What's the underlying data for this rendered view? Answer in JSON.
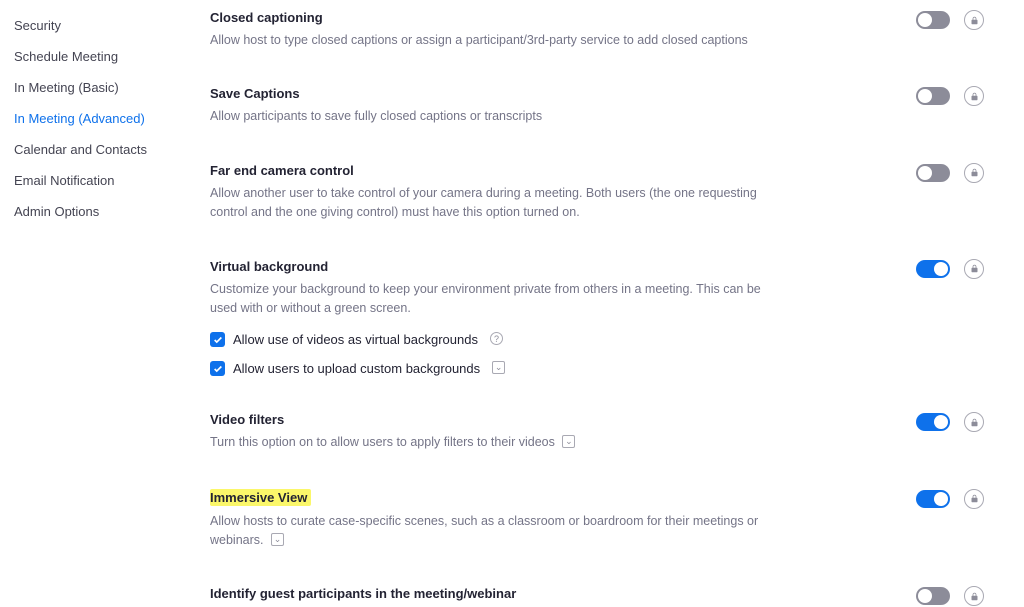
{
  "sidebar": {
    "items": [
      {
        "label": "Security",
        "active": false
      },
      {
        "label": "Schedule Meeting",
        "active": false
      },
      {
        "label": "In Meeting (Basic)",
        "active": false
      },
      {
        "label": "In Meeting (Advanced)",
        "active": true
      },
      {
        "label": "Calendar and Contacts",
        "active": false
      },
      {
        "label": "Email Notification",
        "active": false
      },
      {
        "label": "Admin Options",
        "active": false
      }
    ]
  },
  "settings": {
    "closed_captioning": {
      "title": "Closed captioning",
      "desc": "Allow host to type closed captions or assign a participant/3rd-party service to add closed captions",
      "enabled": false
    },
    "save_captions": {
      "title": "Save Captions",
      "desc": "Allow participants to save fully closed captions or transcripts",
      "enabled": false
    },
    "far_end_camera": {
      "title": "Far end camera control",
      "desc": "Allow another user to take control of your camera during a meeting. Both users (the one requesting control and the one giving control) must have this option turned on.",
      "enabled": false
    },
    "virtual_background": {
      "title": "Virtual background",
      "desc": "Customize your background to keep your environment private from others in a meeting. This can be used with or without a green screen.",
      "enabled": true,
      "opt_videos": "Allow use of videos as virtual backgrounds",
      "opt_upload": "Allow users to upload custom backgrounds"
    },
    "video_filters": {
      "title": "Video filters",
      "desc": "Turn this option on to allow users to apply filters to their videos",
      "enabled": true
    },
    "immersive_view": {
      "title": "Immersive View",
      "desc": "Allow hosts to curate case-specific scenes, such as a classroom or boardroom for their meetings or webinars.",
      "enabled": true
    },
    "identify_guests": {
      "title": "Identify guest participants in the meeting/webinar",
      "enabled": false
    }
  }
}
